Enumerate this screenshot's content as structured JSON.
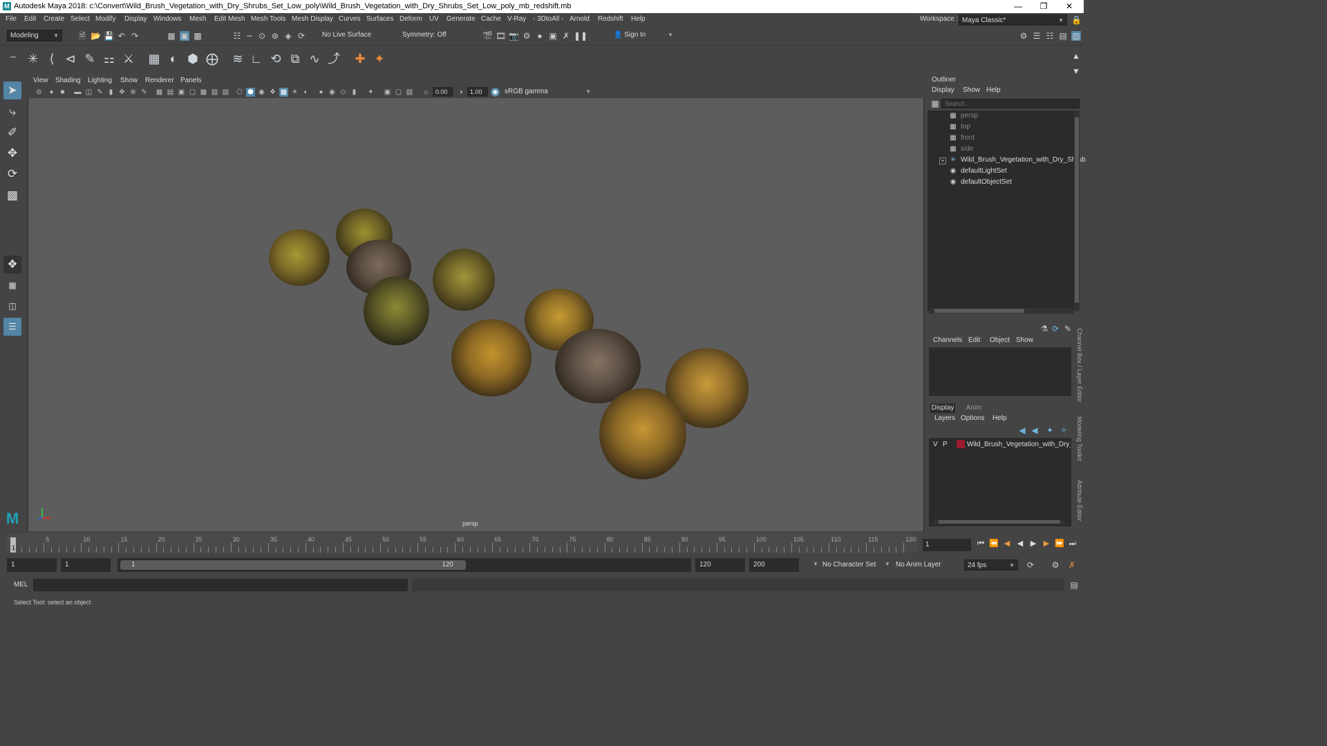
{
  "window": {
    "title": "Autodesk Maya 2018: c:\\Convert\\Wild_Brush_Vegetation_with_Dry_Shrubs_Set_Low_poly\\Wild_Brush_Vegetation_with_Dry_Shrubs_Set_Low_poly_mb_redshift.mb",
    "logo_letter": "M"
  },
  "menubar": {
    "items": [
      "File",
      "Edit",
      "Create",
      "Select",
      "Modify",
      "Display",
      "Windows",
      "Mesh",
      "Edit Mesh",
      "Mesh Tools",
      "Mesh Display",
      "Curves",
      "Surfaces",
      "Deform",
      "UV",
      "Generate",
      "Cache",
      "V-Ray",
      "- 3DtoAll -",
      "Arnold",
      "Redshift",
      "Help"
    ],
    "workspace_label": "Workspace :",
    "workspace_value": "Maya Classic*"
  },
  "statusline": {
    "mode": "Modeling",
    "live_surface": "No Live Surface",
    "symmetry": "Symmetry: Off",
    "sign_in": "Sign In"
  },
  "viewport": {
    "menu": [
      "View",
      "Shading",
      "Lighting",
      "Show",
      "Renderer",
      "Panels"
    ],
    "exposure": "0.00",
    "gamma": "1.00",
    "color_space": "sRGB gamma",
    "camera_label": "persp"
  },
  "outliner": {
    "title": "Outliner",
    "menu": [
      "Display",
      "Show",
      "Help"
    ],
    "search_placeholder": "Search...",
    "items": [
      {
        "label": "persp",
        "icon": "camera-icon",
        "dim": true
      },
      {
        "label": "top",
        "icon": "camera-icon",
        "dim": true
      },
      {
        "label": "front",
        "icon": "camera-icon",
        "dim": true
      },
      {
        "label": "side",
        "icon": "camera-icon",
        "dim": true
      },
      {
        "label": "Wild_Brush_Vegetation_with_Dry_Shrub",
        "icon": "group-icon",
        "dim": false
      },
      {
        "label": "defaultLightSet",
        "icon": "set-icon",
        "dim": false
      },
      {
        "label": "defaultObjectSet",
        "icon": "set-icon",
        "dim": false
      }
    ]
  },
  "channelbox": {
    "menu": [
      "Channels",
      "Edit",
      "Object",
      "Show"
    ],
    "tabs": [
      "Display",
      "Anim"
    ],
    "layer_menu": [
      "Layers",
      "Options",
      "Help"
    ],
    "layer": {
      "v": "V",
      "p": "P",
      "name": "Wild_Brush_Vegetation_with_Dry_Sh",
      "color": "#9b1b30"
    }
  },
  "side_tabs": [
    "Channel Box / Layer Editor",
    "Modeling Toolkit",
    "Attribute Editor"
  ],
  "timeline": {
    "ticks": [
      "5",
      "10",
      "15",
      "20",
      "25",
      "30",
      "35",
      "40",
      "45",
      "50",
      "55",
      "60",
      "65",
      "70",
      "75",
      "80",
      "85",
      "90",
      "95",
      "100",
      "105",
      "110",
      "115",
      "120"
    ],
    "current_frame": "1",
    "frame_field": "1"
  },
  "range": {
    "start": "1",
    "playback_start": "1",
    "slider_start": "1",
    "slider_end": "120",
    "playback_end": "120",
    "end": "200",
    "character_set": "No Character Set",
    "anim_layer": "No Anim Layer",
    "fps": "24 fps"
  },
  "command": {
    "label": "MEL"
  },
  "help": {
    "text": "Select Tool: select an object"
  }
}
